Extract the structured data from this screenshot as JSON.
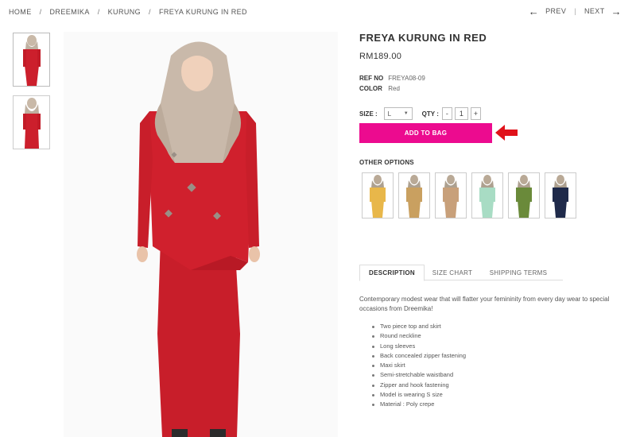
{
  "breadcrumb": [
    "HOME",
    "DREEMIKA",
    "KURUNG",
    "FREYA KURUNG IN RED"
  ],
  "pager": {
    "prev": "PREV",
    "next": "NEXT"
  },
  "product": {
    "title": "FREYA KURUNG IN RED",
    "price": "RM189.00",
    "ref_label": "REF NO",
    "ref_value": "FREYA08-09",
    "color_label": "COLOR",
    "color_value": "Red"
  },
  "size": {
    "label": "SIZE :",
    "value": "L"
  },
  "qty": {
    "label": "QTY :",
    "minus": "-",
    "value": "1",
    "plus": "+"
  },
  "add_to_bag": "ADD TO BAG",
  "other_options": {
    "title": "OTHER OPTIONS",
    "swatches": [
      "#e8b74a",
      "#c9a060",
      "#c8a07a",
      "#a8dcc4",
      "#6a8a3a",
      "#1f2a4a"
    ]
  },
  "tabs": [
    "DESCRIPTION",
    "SIZE CHART",
    "SHIPPING TERMS"
  ],
  "description": {
    "intro": "Contemporary modest wear that will flatter your  femininity from every day wear to special occasions from Dreemika!",
    "bullets": [
      "Two piece top and skirt",
      "Round neckline",
      "Long sleeves",
      "Back concealed zipper fastening",
      "Maxi skirt",
      "Semi-stretchable waistband",
      "Zipper and hook fastening",
      "Model is wearing S size",
      "Material : Poly crepe"
    ]
  },
  "colors": {
    "accent": "#ec0b8f",
    "dress": "#cc1f2c",
    "arrow": "#e0121a"
  }
}
